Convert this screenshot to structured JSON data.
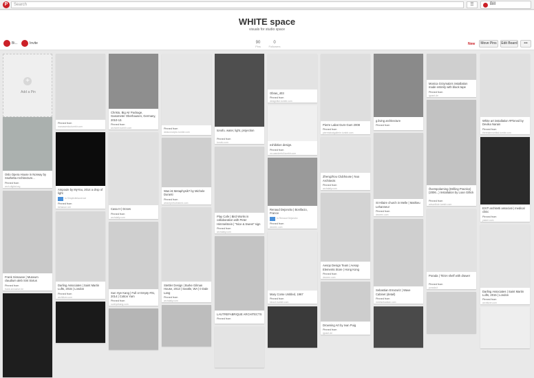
{
  "search": {
    "placeholder": "Search"
  },
  "user": {
    "name": "Bill"
  },
  "board": {
    "title": "WHITE space",
    "subtitle": "visuals for studio space",
    "owners": [
      {
        "label": "Bi..."
      },
      {
        "label": "Invite"
      }
    ],
    "stats": [
      {
        "value": "90",
        "label": "Pins"
      },
      {
        "value": "0",
        "label": "Followers"
      }
    ],
    "new_label": "New",
    "move_pins": "Move Pins",
    "edit_board": "Edit Board",
    "more": "•••"
  },
  "add_pin": {
    "label": "Add a Pin",
    "plus": "+"
  },
  "pinned_from": "Pinned from",
  "columns": [
    [
      {
        "desc": "Oslo Opera House in Norway by Snøhetta Architecture...",
        "src": "arch-digital.org",
        "tone": "#aab0ae"
      },
      {
        "desc": "Frank Sinnaeve | Museum claudium aleb Sint Sixtus",
        "src": "frank-sinnaeve.be",
        "tone": "#c9c9c9"
      },
      {
        "desc": "",
        "src": "",
        "tone": "#1e1e1e"
      }
    ],
    [
      {
        "desc": "",
        "src": "marcasenka.tumblr.com",
        "tone": "#dcdcdc"
      },
      {
        "desc": "Ampoule by MyYou, 2014 a drop of light",
        "src": "behance.net",
        "tag": "to Simplicitelaurence",
        "tone": "#0c0c0c"
      },
      {
        "desc": "Darling Associates | Saint Martin Lufts, 2015 | London",
        "src": "architizer.com",
        "tone": "#d8d8d8"
      },
      {
        "desc": "",
        "src": "",
        "tone": "#1a1a1a"
      }
    ],
    [
      {
        "desc": "Christo, Big Air Package, Gasometer Oberhausen, Germany, 2010-13.",
        "src": "archizeit.tumblr.com",
        "tone": "#8e8e8e"
      },
      {
        "desc": "Casa H | Dcses",
        "src": "archdaily.com",
        "tone": "#e0e0e0"
      },
      {
        "desc": "Sun Hye Kang | Full or Empty #01, 2014 | Cotton Yarn",
        "src": "sunhyekang.com",
        "tone": "#cfcfcf"
      },
      {
        "desc": "",
        "src": "",
        "tone": "#b5b5b5"
      }
    ],
    [
      {
        "desc": "",
        "src": "delaconcepto.tumblr.com",
        "tone": "#e6e6e6"
      },
      {
        "desc": "Was ist Metaphysik? by Michele Duranti",
        "src": "weareprefurbished.com",
        "tone": "#cfcfcf"
      },
      {
        "desc": "Stettler Design | Burke Gilman House, 2013 | Seattle, WA | 0 Dale Lang",
        "src": "archdaily.com",
        "tone": "#dcdcdc"
      },
      {
        "desc": "",
        "src": "",
        "tone": "#bdbdbd"
      }
    ],
    [
      {
        "desc": "tonofu. water, light, projection",
        "src": "tonofu.com",
        "tone": "#4e4e4e"
      },
      {
        "desc": "Play Cafe | Bird Works in collaboration with Peter Himmelstein | \"Nice & Sweet\" sign",
        "src": "archdaily.com",
        "tone": "#d6d6d6"
      },
      {
        "desc": "LAUTREFABRIQUE ARCHITECTS",
        "src": "",
        "tone": "#c4c4c4"
      },
      {
        "desc": "",
        "src": "",
        "tone": "#e4e4e4"
      }
    ],
    [
      {
        "desc": "Obras_403",
        "src": "designlike.tumblr.com",
        "tone": "#e3e3e3"
      },
      {
        "desc": "exhibition design.",
        "src": "mr-wanderfull.tumblr.com",
        "tone": "#f0f0f0"
      },
      {
        "desc": "Renaud Dejonckx | Bonifacio, France",
        "src": "dezeen.com",
        "tag": "to Renaud Dejonckx",
        "tone": "#9a9a9a"
      },
      {
        "desc": "Mary Corse Untitled, 1967",
        "src": "kinoch.tumblr.com",
        "tone": "#e8e8e8"
      },
      {
        "desc": "",
        "src": "",
        "tone": "#3a3a3a"
      }
    ],
    [
      {
        "desc": "Pierre Labat Gum-Gum 2008",
        "src": "pierrelabatgallerie.tumblr.com",
        "tone": "#dedede"
      },
      {
        "desc": "Zhengzhou Clubhouse | Nuo Architects",
        "src": "archdaily.com",
        "tone": "#e2e2e2"
      },
      {
        "desc": "Aesop Design Team | Aesop Elements Store | Hong Kong",
        "src": "dezeen.com",
        "tone": "#d3d3d3"
      },
      {
        "desc": "Drowning Art by Ivan Puig",
        "src": "ignant.de",
        "tone": "#cdcdcd"
      }
    ],
    [
      {
        "desc": "g.living architecture",
        "src": "",
        "tone": "#8a8a8a"
      },
      {
        "desc": "St Hilaire church in Melle | Mathieu Lehanneur",
        "src": "dezeen.com",
        "tone": "#d2d2d2"
      },
      {
        "desc": "Sebastian Errazuriz | Wave Cabinet (detail)",
        "src": "meetsebastian.com",
        "tone": "#cfcfcf"
      },
      {
        "desc": "",
        "src": "",
        "tone": "#4a4a4a"
      }
    ],
    [
      {
        "desc": "Monica Grzymala's installation made entirely with black tape",
        "src": "ignant.de",
        "tone": "#cfcfcf"
      },
      {
        "desc": "Överspolarning (Drilling Practice) (2006...) Installation by Loan Gillick",
        "src": "artsonflute.tumblr.com",
        "tone": "#c2c2c2"
      },
      {
        "desc": "Porada | TESA shelf with drawer",
        "src": "porada.it",
        "tone": "#e2e2e2"
      },
      {
        "desc": "",
        "src": "",
        "tone": "#d0d0d0"
      }
    ],
    [
      {
        "desc": "White art installation #Pinned by Devika Narain",
        "src": "therealmrsmittal.tumblr.com",
        "tone": "#e0e0e0"
      },
      {
        "desc": "EXIT architetti associati | medical clinic",
        "src": "yatzer.com",
        "tone": "#2a2a2a"
      },
      {
        "desc": "Darling Associates | Saint Martin Lufts, 2015 | London",
        "src": "architizer.com",
        "tone": "#e4e4e4"
      },
      {
        "desc": "",
        "src": "",
        "tone": "#eeeeee"
      }
    ]
  ]
}
